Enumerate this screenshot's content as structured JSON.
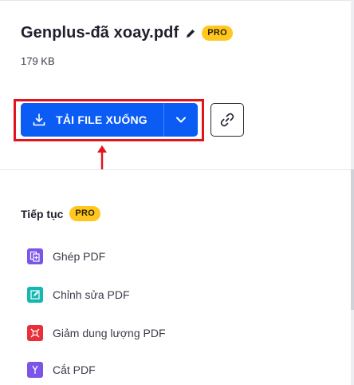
{
  "file": {
    "name": "Genplus-đã xoay.pdf",
    "size": "179 KB",
    "pro_label": "PRO"
  },
  "actions": {
    "download_label": "TẢI FILE XUỐNG"
  },
  "continue_section": {
    "title": "Tiếp tục",
    "pro_label": "PRO",
    "tools": [
      {
        "label": "Ghép PDF",
        "color": "#7a55e8",
        "icon": "merge-icon"
      },
      {
        "label": "Chỉnh sửa PDF",
        "color": "#15b8b0",
        "icon": "edit-icon"
      },
      {
        "label": "Giảm dung lượng PDF",
        "color": "#e8303a",
        "icon": "compress-icon"
      },
      {
        "label": "Cắt PDF",
        "color": "#7a55e8",
        "icon": "split-icon"
      }
    ]
  },
  "colors": {
    "primary": "#0a5cf5",
    "pro_badge": "#ffc71f",
    "highlight": "#e3131e"
  }
}
